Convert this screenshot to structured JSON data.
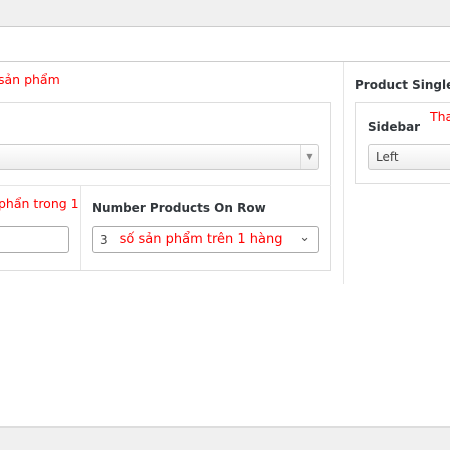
{
  "left": {
    "note_title": "sản phẩm",
    "note_column": "phẩn trong 1",
    "number_on_row": {
      "label": "Number Products On Row",
      "value": "3",
      "note": "số sản phẩm trên 1 hàng"
    }
  },
  "right": {
    "section_title": "Product Single",
    "sidebar": {
      "label": "Sidebar",
      "note": "Tha",
      "value": "Left"
    }
  }
}
